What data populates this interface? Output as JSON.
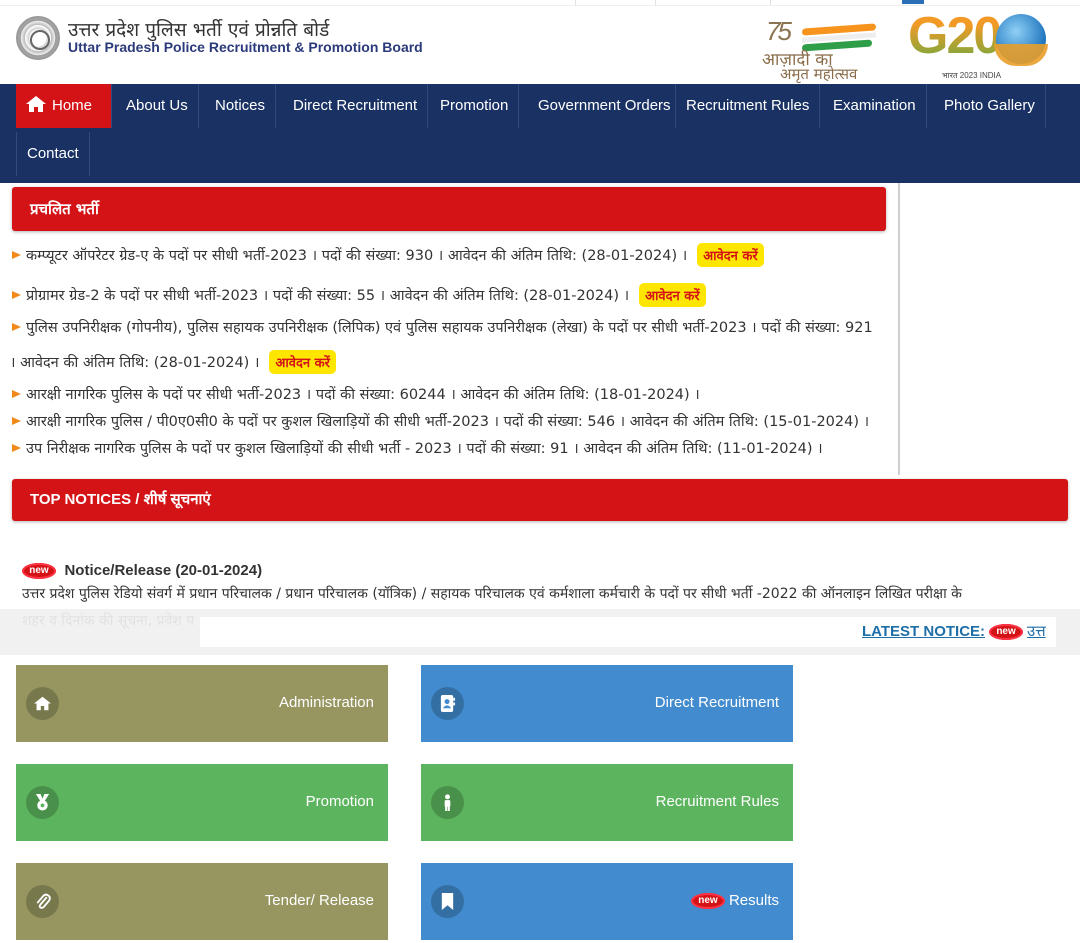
{
  "header": {
    "title_hindi": "उत्तर प्रदेश पुलिस भर्ती एवं प्रोन्नति बोर्ड",
    "title_english": "Uttar Pradesh Police Recruitment & Promotion Board",
    "azadi_logo": {
      "number": "75",
      "line1": "आज़ादी का",
      "line2": "अमृत महोत्सव"
    },
    "g20_logo": {
      "text": "G20",
      "subtitle": "भारत 2023 INDIA"
    }
  },
  "nav": {
    "items": [
      {
        "label": "Home",
        "icon": "home-icon",
        "active": true
      },
      {
        "label": "About Us"
      },
      {
        "label": "Notices"
      },
      {
        "label": "Direct Recruitment"
      },
      {
        "label": "Promotion"
      },
      {
        "label": "Government Orders"
      },
      {
        "label": "Recruitment Rules"
      },
      {
        "label": "Examination"
      },
      {
        "label": "Photo Gallery"
      },
      {
        "label": "Contact"
      }
    ]
  },
  "current_recruitment": {
    "heading": "प्रचलित भर्ती",
    "apply_label": "आवेदन करें",
    "items": [
      {
        "text": "कम्प्यूटर ऑपरेटर ग्रेड-ए के पदों पर सीधी भर्ती-2023 । पदों की संख्या: 930 । आवेदन की अंतिम तिथि: (28-01-2024) ।",
        "has_apply": true
      },
      {
        "text": "प्रोग्रामर ग्रेड-2 के पदों पर सीधी भर्ती-2023 । पदों की संख्या: 55 । आवेदन की अंतिम तिथि: (28-01-2024) ।",
        "has_apply": true
      },
      {
        "text": "पुलिस उपनिरीक्षक (गोपनीय), पुलिस सहायक उपनिरीक्षक (लिपिक) एवं पुलिस सहायक उपनिरीक्षक (लेखा) के पदों पर सीधी भर्ती-2023 । पदों की संख्या: 921",
        "text_line2": "। आवेदन की अंतिम तिथि: (28-01-2024) ।",
        "has_apply": true
      },
      {
        "text": "आरक्षी नागरिक पुलिस के पदों पर सीधी भर्ती-2023 । पदों की संख्या: 60244 । आवेदन की अंतिम तिथि: (18-01-2024) ।",
        "has_apply": false
      },
      {
        "text": "आरक्षी नागरिक पुलिस / पी0ए0सी0 के पदों पर कुशल खिलाड़ियों की सीधी भर्ती-2023 । पदों की संख्या: 546 । आवेदन की अंतिम तिथि: (15-01-2024) ।",
        "has_apply": false
      },
      {
        "text": "उप निरीक्षक नागरिक पुलिस के पदों पर कुशल खिलाड़ियों की सीधी भर्ती - 2023 । पदों की संख्या: 91 । आवेदन की अंतिम तिथि: (11-01-2024) ।",
        "has_apply": false
      }
    ]
  },
  "top_notices": {
    "heading": "TOP NOTICES / शीर्ष सूचनाएं",
    "new_badge": "new",
    "notice": {
      "title": "Notice/Release (20-01-2024)",
      "line1": "उत्तर प्रदेश पुलिस रेडियो संवर्ग में प्रधान परिचालक / प्रधान परिचालक (यॉत्रिक) / सहायक परिचालक एवं कर्मशाला कर्मचारी के पदों पर सीधी भर्ती -2022 की ऑनलाइन लिखित परीक्षा के",
      "line2": "शहर व दिनांक की सूचना, प्रवेश प"
    }
  },
  "latest_notice": {
    "label": "LATEST NOTICE:",
    "new_badge": "new",
    "text": "उत्त"
  },
  "tiles": [
    {
      "label": "Administration",
      "icon": "home-icon",
      "color": "#979661"
    },
    {
      "label": "Direct Recruitment",
      "icon": "contact-book-icon",
      "color": "#428bce"
    },
    {
      "label": "Promotion",
      "icon": "medal-icon",
      "color": "#5cb55e"
    },
    {
      "label": "Recruitment Rules",
      "icon": "person-icon",
      "color": "#5cb55e"
    },
    {
      "label": "Tender/ Release",
      "icon": "paperclip-icon",
      "color": "#979661"
    },
    {
      "label": "Results",
      "icon": "bookmark-icon",
      "color": "#428bce",
      "new_badge": "new"
    }
  ],
  "colors": {
    "nav_bg": "#1a3263",
    "accent_red": "#d41317",
    "apply_yellow": "#ffe600",
    "bullet_orange": "#f08a1a"
  }
}
